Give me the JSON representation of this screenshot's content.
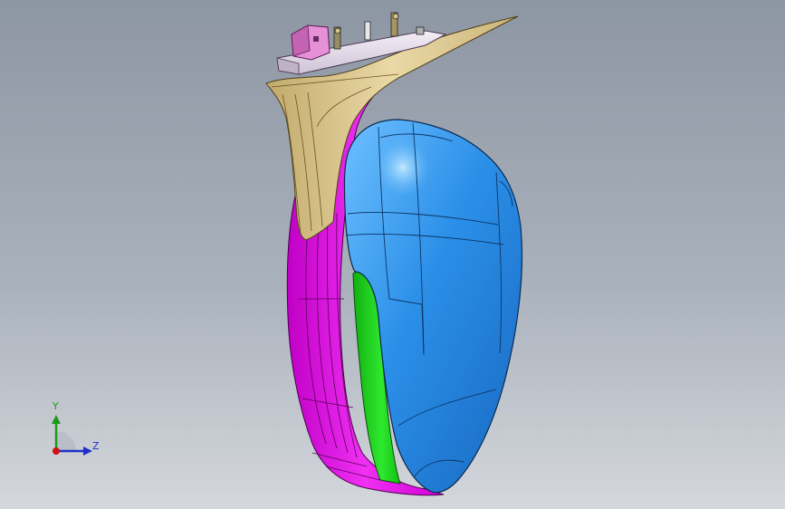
{
  "viewport": {
    "background_top": "#8d96a3",
    "background_bottom": "#d4d7dc"
  },
  "model": {
    "part_colors": {
      "housing_cover": "#2a8ee6",
      "housing_cover_highlight": "#7cc6ff",
      "casing": "#e400e6",
      "glass_strip": "#1fd11f",
      "arm_bracket": "#e2cf9a",
      "arm_bracket_shadow": "#b59d61",
      "mounting_plate": "#ece4f0",
      "connector": "#e07ad0"
    }
  },
  "triad": {
    "y_label": "Y",
    "z_label": "Z",
    "y_color": "#1c9a1c",
    "z_color": "#2030c8",
    "x_color": "#d01010"
  }
}
